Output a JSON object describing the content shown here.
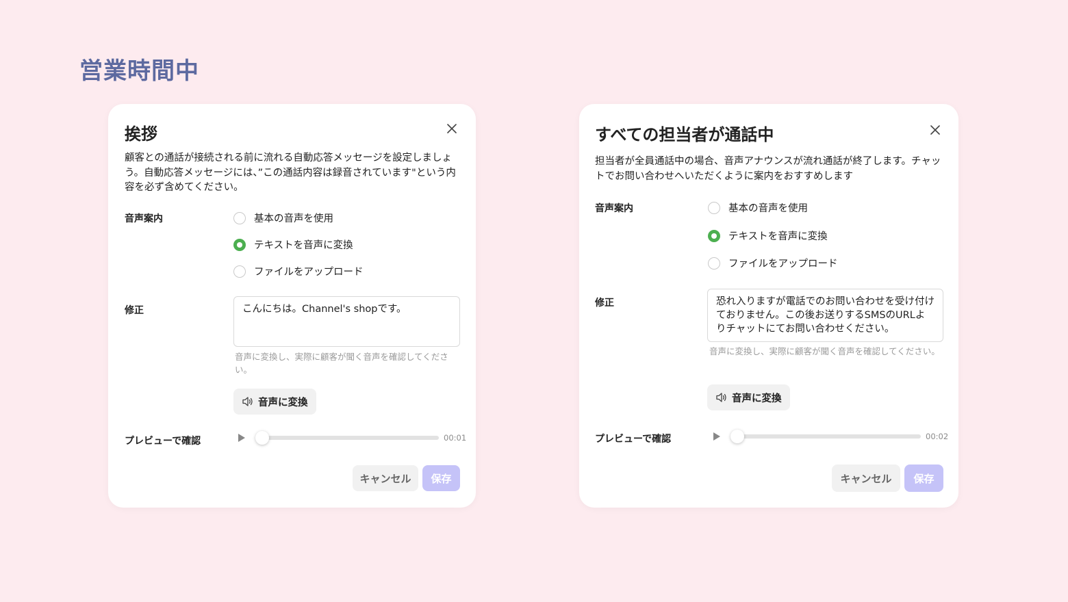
{
  "page_title": "営業時間中",
  "dialogs": [
    {
      "title": "挨拶",
      "description": "顧客との通話が接続される前に流れる自動応答メッセージを設定しましょう。自動応答メッセージには、”この通話内容は録音されています\"という内容を必ず含めてください。",
      "voice_label": "音声案内",
      "options": [
        "基本の音声を使用",
        "テキストを音声に変換",
        "ファイルをアップロード"
      ],
      "selected_option": "テキストを音声に変換",
      "edit_label": "修正",
      "text_value": "こんにちは。Channel's shopです。",
      "hint": "音声に変換し、実際に顧客が聞く音声を確認してください。",
      "convert_button": "音声に変換",
      "preview_label": "プレビューで確認",
      "playback_progress": 0,
      "time": "00:01",
      "cancel": "キャンセル",
      "save": "保存"
    },
    {
      "title": "すべての担当者が通話中",
      "description": "担当者が全員通話中の場合、音声アナウンスが流れ通話が終了します。チャットでお問い合わせへいただくように案内をおすすめします",
      "voice_label": "音声案内",
      "options": [
        "基本の音声を使用",
        "テキストを音声に変換",
        "ファイルをアップロード"
      ],
      "selected_option": "テキストを音声に変換",
      "edit_label": "修正",
      "text_value": "恐れ入りますが電話でのお問い合わせを受け付けておりません。この後お送りするSMSのURLよりチャットにてお問い合わせください。",
      "hint": "音声に変換し、実際に顧客が聞く音声を確認してください。",
      "convert_button": "音声に変換",
      "preview_label": "プレビューで確認",
      "playback_progress": 0,
      "time": "00:02",
      "cancel": "キャンセル",
      "save": "保存"
    }
  ],
  "colors": {
    "background": "#fdebef",
    "title": "#5d6aa0",
    "radio_selected": "#4caf50",
    "save_disabled": "#c5c3f8"
  },
  "icons": [
    "close-icon",
    "speaker-icon",
    "play-icon"
  ]
}
